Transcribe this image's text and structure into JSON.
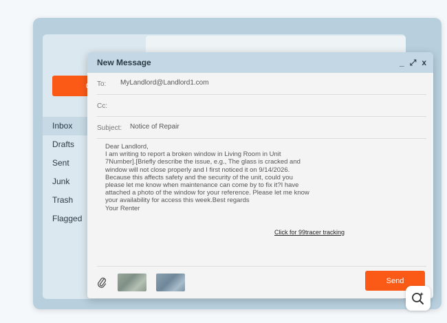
{
  "app": {
    "compose_button_label": "Co",
    "folders": [
      {
        "label": "Inbox",
        "active": true
      },
      {
        "label": "Drafts",
        "active": false
      },
      {
        "label": "Sent",
        "active": false
      },
      {
        "label": "Junk",
        "active": false
      },
      {
        "label": "Trash",
        "active": false
      },
      {
        "label": "Flagged",
        "active": false
      }
    ]
  },
  "compose": {
    "title": "New Message",
    "controls": {
      "minimize": "_",
      "expand": "⤢",
      "close": "x"
    },
    "to_label": "To:",
    "to_value": "MyLandlord@Landlord1.com",
    "cc_label": "Cc:",
    "cc_value": "",
    "subject_label": "Subject:",
    "subject_value": "Notice of Repair",
    "body": "Dear Landlord,\nI am writing to report a broken window in Living Room in Unit\n7Number].[Briefly describe the issue, e.g., The glass is cracked and\nwindow will not close properly and I first noticed it on 9/14/2026.\nBecause this affects safety and the security of the unit, could you\nplease let me know when maintenance can come by to fix it?I have\nattached a photo of the window for your reference. Please let me know\nyour availability for access this week.Best regards\nYour Renter",
    "tracking_link": "Click for 99tracer tracking",
    "send_label": "Send"
  },
  "colors": {
    "accent": "#fb5a16",
    "header": "#c3d8e4",
    "frame": "#b8d0de"
  }
}
